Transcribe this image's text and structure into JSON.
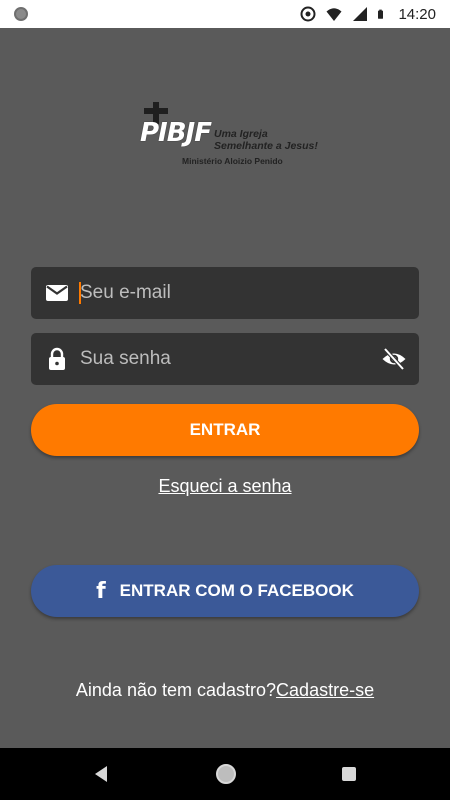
{
  "status_bar": {
    "time": "14:20",
    "icons": [
      "circle-dot-icon",
      "data-saver-icon",
      "wifi-icon",
      "signal-icon",
      "battery-icon"
    ]
  },
  "logo": {
    "main": "PIBJF",
    "tagline_line1": "Uma Igreja",
    "tagline_line2": "Semelhante a Jesus!",
    "subtitle": "Ministério Aloizio Penido"
  },
  "form": {
    "email_placeholder": "Seu e-mail",
    "password_placeholder": "Sua senha",
    "email_icon": "mail-icon",
    "password_icon": "lock-icon",
    "toggle_icon": "eye-off-icon"
  },
  "actions": {
    "login_label": "ENTRAR",
    "forgot_label": "Esqueci a senha",
    "facebook_label": "ENTRAR COM O FACEBOOK",
    "facebook_icon": "facebook-icon",
    "signup_prompt": "Ainda não tem cadastro?",
    "signup_link": "Cadastre-se"
  },
  "colors": {
    "background": "#5a5a5a",
    "field": "#333333",
    "accent": "#ff7a00",
    "facebook": "#3b5998"
  }
}
